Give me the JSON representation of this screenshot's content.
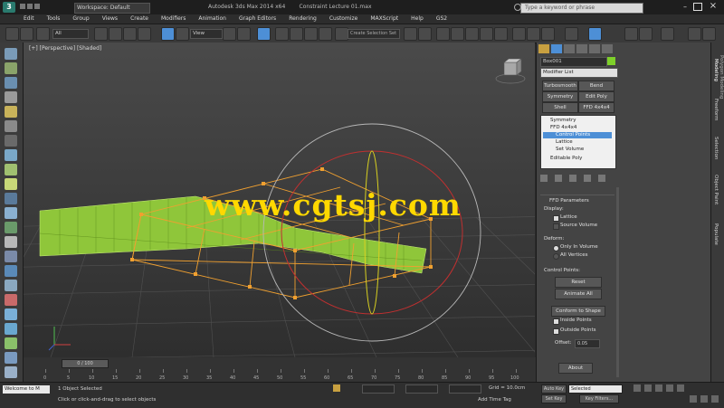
{
  "title_bar": {
    "workspace": "Workspace: Default",
    "doc_title": "Autodesk 3ds Max 2014 x64",
    "file": "Constraint Lecture 01.max",
    "search_placeholder": "Type a keyword or phrase"
  },
  "menu": [
    "Edit",
    "Tools",
    "Group",
    "Views",
    "Create",
    "Modifiers",
    "Animation",
    "Graph Editors",
    "Rendering",
    "Customize",
    "MAXScript",
    "Help",
    "GS2"
  ],
  "toolbar": {
    "filter": "All",
    "view": "View",
    "selection_set": "Create Selection Set"
  },
  "viewport": {
    "label": "[+] [Perspective] [Shaded]",
    "watermark": "www.cgtsj.com"
  },
  "command_panel": {
    "object_name": "Box001",
    "modifier_list": "Modifier List",
    "buttons": [
      "Turbosmooth",
      "Bend",
      "Symmetry",
      "Edit Poly",
      "Shell",
      "FFD 4x4x4"
    ],
    "stack": [
      "Symmetry",
      "FFD 4x4x4",
      "Control Points",
      "Lattice",
      "Set Volume",
      "Editable Poly"
    ],
    "rollout_title": "FFD Parameters",
    "display_label": "Display:",
    "lattice": "Lattice",
    "source_volume": "Source Volume",
    "deform_label": "Deform:",
    "only_in_volume": "Only In Volume",
    "all_vertices": "All Vertices",
    "control_points_label": "Control Points:",
    "reset": "Reset",
    "animate_all": "Animate All",
    "conform": "Conform to Shape",
    "inside_points": "Inside Points",
    "outside_points": "Outside Points",
    "offset_label": "Offset:",
    "offset_value": "0.05",
    "about": "About"
  },
  "ribbon_tabs": [
    "Modeling",
    "Freeform",
    "Selection",
    "Object Paint",
    "Populate"
  ],
  "ribbon_subtab": "Polygon Modeling",
  "timeline": {
    "frame": "0 / 100",
    "ticks": [
      "0",
      "5",
      "10",
      "15",
      "20",
      "25",
      "30",
      "35",
      "40",
      "45",
      "50",
      "55",
      "60",
      "65",
      "70",
      "75",
      "80",
      "85",
      "90",
      "95",
      "100"
    ]
  },
  "status": {
    "welcome": "Welcome to M",
    "selected": "1 Object Selected",
    "prompt": "Click or click-and-drag to select objects",
    "grid": "Grid = 10.0cm",
    "auto_key": "Auto Key",
    "set_key": "Set Key",
    "key_filter_value": "Selected",
    "add_time_tag": "Add Time Tag",
    "key_filters": "Key Filters..."
  },
  "colors": {
    "accent": "#4d8fd6",
    "lattice": "#f0a030",
    "mesh": "#8fc63a",
    "object_color": "#7ed02a",
    "watermark": "#ffd800"
  }
}
